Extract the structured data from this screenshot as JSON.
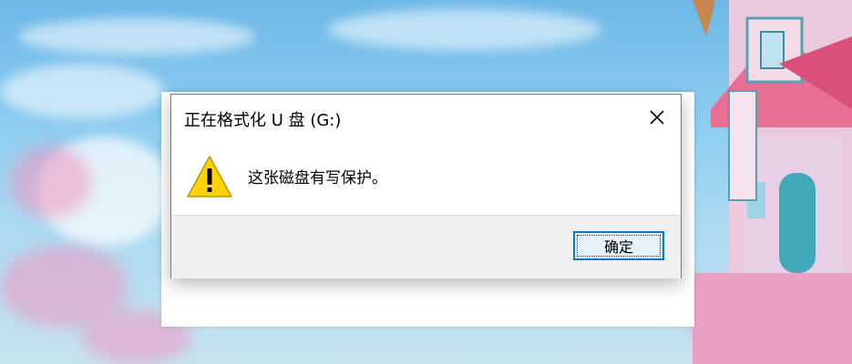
{
  "dialog": {
    "title": "正在格式化 U 盘 (G:)",
    "message": "这张磁盘有写保护。",
    "ok_label": "确定"
  },
  "icons": {
    "warning": "warning-icon",
    "close": "close-icon"
  },
  "colors": {
    "accent": "#0078d7",
    "warning_fill": "#ffd700",
    "footer_bg": "#f0f0f0"
  }
}
